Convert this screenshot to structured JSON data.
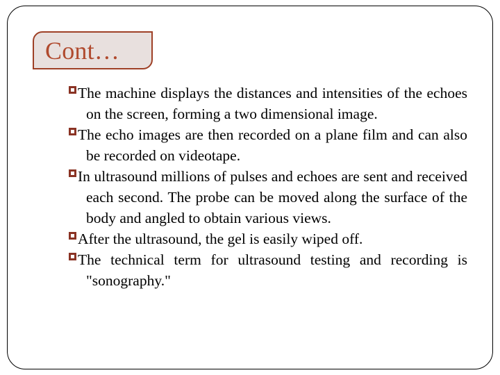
{
  "slide": {
    "title": "Cont…",
    "title_color": "#b04a2e",
    "title_box_fill": "#e8e0de",
    "title_box_border_color": "#9e4026",
    "frame_border_color": "#000000",
    "background_color": "#ffffff",
    "bullet_marker_color": "#8a3324",
    "bullet_marker_icon": "hollow-square-bullet-icon",
    "body_text_color": "#000000",
    "bullets": [
      {
        "text": "The machine displays the distances and intensities of the echoes on the screen, forming a two dimensional image."
      },
      {
        "text": "The echo images are then recorded on a plane film and can also be recorded on videotape."
      },
      {
        "text": "In ultrasound millions of pulses and echoes are sent and received each second. The probe can be moved along the surface of the body and angled to obtain various views."
      },
      {
        "text": "After the ultrasound, the gel is easily wiped off."
      },
      {
        "text": "The technical term for ultrasound testing and recording is \"sonography.\""
      }
    ]
  }
}
